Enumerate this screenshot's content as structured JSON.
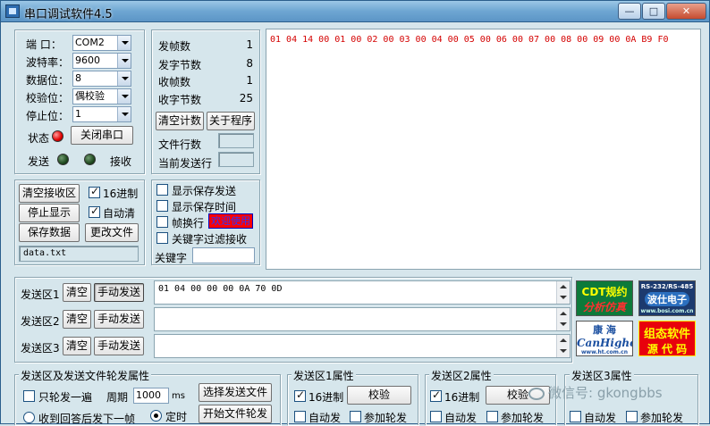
{
  "window": {
    "title": "串口调试软件4.5",
    "minimize": "—",
    "maximize": "□",
    "close": "✕"
  },
  "port": {
    "port_label": "端  口：",
    "port_value": "COM2",
    "baud_label": "波特率：",
    "baud_value": "9600",
    "data_label": "数据位：",
    "data_value": "8",
    "parity_label": "校验位：",
    "parity_value": "偶校验",
    "stop_label": "停止位：",
    "stop_value": "1",
    "status_label": "状态",
    "close_port_button": "关闭串口",
    "send_label": "发送",
    "recv_label": "接收"
  },
  "counters": {
    "frames_sent_label": "发帧数",
    "frames_sent": "1",
    "bytes_sent_label": "发字节数",
    "bytes_sent": "8",
    "frames_recv_label": "收帧数",
    "frames_recv": "1",
    "bytes_recv_label": "收字节数",
    "bytes_recv": "25",
    "clear_count_button": "清空计数",
    "about_button": "关于程序",
    "file_lines_label": "文件行数",
    "current_line_label": "当前发送行"
  },
  "recv_controls": {
    "clear_recv_button": "清空接收区",
    "hex_label": "16进制",
    "stop_display_button": "停止显示",
    "auto_clear_label": "自动清",
    "save_data_button": "保存数据",
    "change_file_button": "更改文件",
    "file_name": "data.txt"
  },
  "display_options": {
    "show_saved_send": "显示保存发送",
    "show_saved_time": "显示保存时间",
    "frame_newline": "帧换行",
    "welcome_badge": "欢迎使用",
    "keyword_filter": "关键字过滤接收",
    "keyword_label": "关键字"
  },
  "receive": {
    "content": "01 04 14 00 01 00 02 00 03 00 04 00 05 00 06 00 07 00 08 00 09 00 0A B9 F0"
  },
  "send": {
    "zone1_label": "发送区1",
    "zone2_label": "发送区2",
    "zone3_label": "发送区3",
    "clear_button": "清空",
    "manual_send_button": "手动发送",
    "zone1_content": "01 04 00 00 00 0A 70 0D",
    "zone2_content": "",
    "zone3_content": ""
  },
  "ads": {
    "cdt_line1": "CDT规约",
    "cdt_line2": "分析仿真",
    "rs_top": "RS-232/RS-485",
    "rs_name": "波仕电子",
    "rs_url": "www.bosi.com.cn",
    "kanghai_cn": "康 海",
    "kanghai_en": "CanHigher",
    "kanghai_url": "www.ht.com.cn",
    "cfg_line1": "组态软件",
    "cfg_line2": "源 代 码"
  },
  "bottom": {
    "rotation_legend": "发送区及发送文件轮发属性",
    "only_rotate_once": "只轮发一遍",
    "period_label": "周期",
    "period_value": "1000",
    "period_unit": "ms",
    "select_file_button": "选择发送文件",
    "recv_reply_next": "收到回答后发下一帧",
    "timed_label": "定时",
    "start_file_rotate_button": "开始文件轮发",
    "zone1_props": "发送区1属性",
    "zone2_props": "发送区2属性",
    "zone3_props": "发送区3属性",
    "hex_label": "16进制",
    "checksum_button": "校验",
    "auto_send_label": "自动发",
    "join_rotate_label": "参加轮发"
  },
  "watermark": "微信号: gkongbbs"
}
